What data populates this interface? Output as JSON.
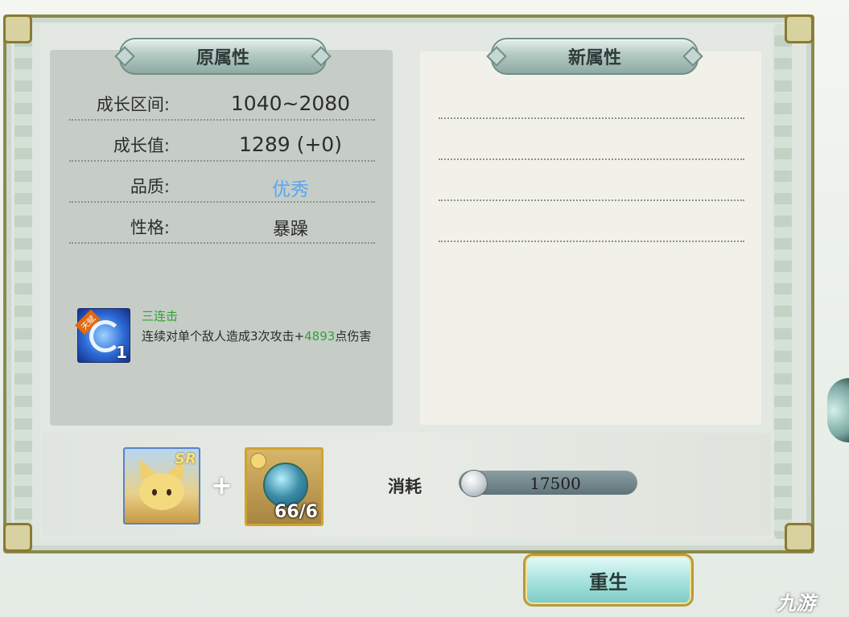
{
  "left_panel": {
    "title": "原属性",
    "rows": [
      {
        "label": "成长区间:",
        "value": "1040~2080"
      },
      {
        "label": "成长值:",
        "value": "1289 (+0)"
      },
      {
        "label": "品质:",
        "value": "优秀"
      },
      {
        "label": "性格:",
        "value": "暴躁"
      }
    ],
    "skill": {
      "icon": "swirl-skill-icon",
      "tag": "天赋",
      "level": "1",
      "name": "三连击",
      "desc_prefix": "连续对单个敌人造成3次攻击+",
      "desc_number": "4893",
      "desc_suffix": "点伤害"
    }
  },
  "right_panel": {
    "title": "新属性"
  },
  "materials": {
    "pet_card": {
      "badge": "SR",
      "icon": "pet-portrait"
    },
    "plus": "+",
    "item_card": {
      "count": "66/6",
      "icon": "orb-item"
    }
  },
  "cost": {
    "label": "消耗",
    "value": "17500",
    "icon": "silver-coin-icon"
  },
  "rebirth_button": "重生",
  "watermark": "九游",
  "colors": {
    "quality_blue": "#58a6f5",
    "skill_green": "#2fa52f",
    "button_teal": "#a9e4df"
  }
}
